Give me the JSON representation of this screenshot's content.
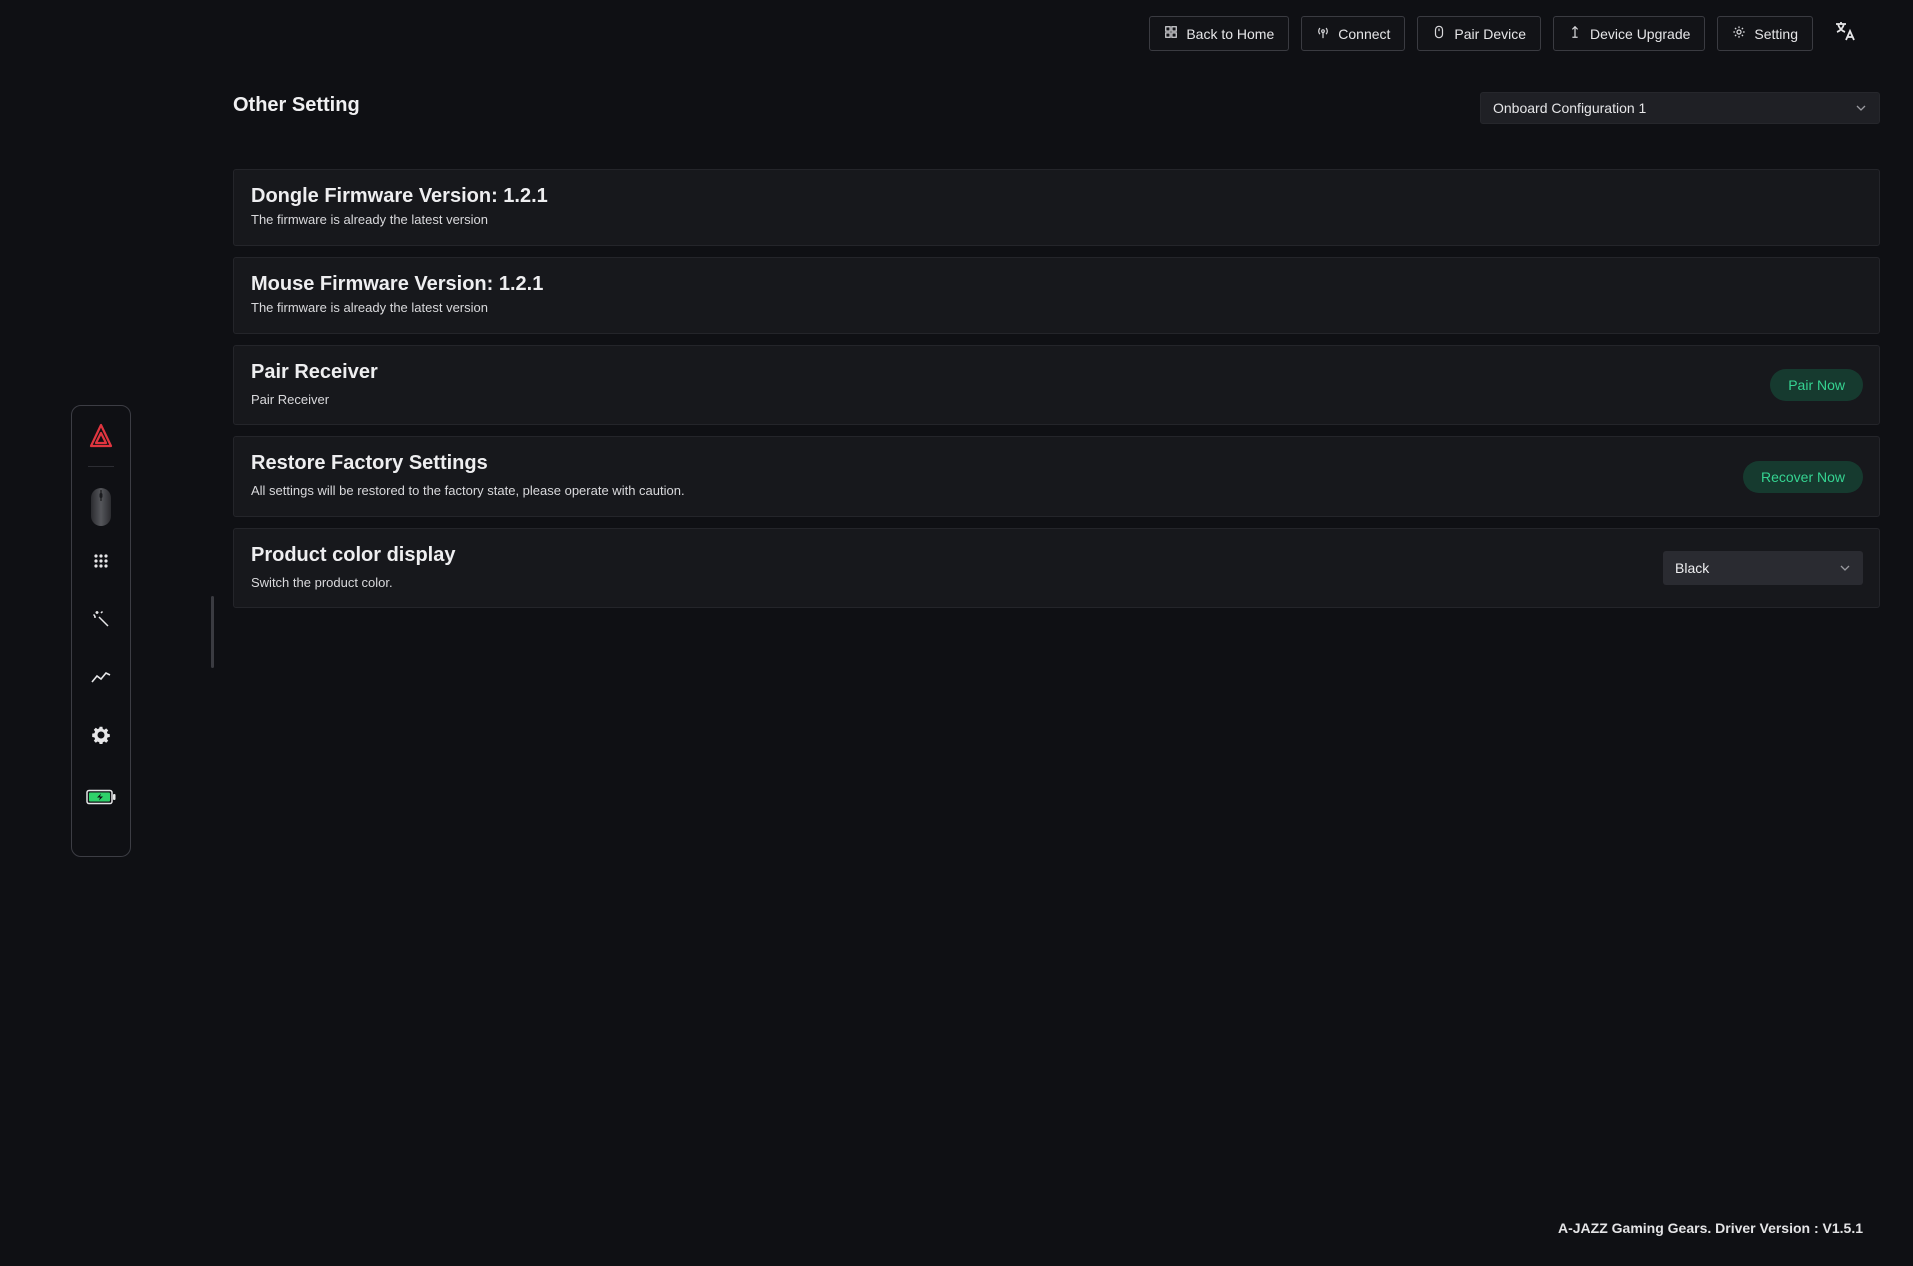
{
  "topbar": {
    "back_to_home": "Back to Home",
    "connect": "Connect",
    "pair_device": "Pair Device",
    "device_upgrade": "Device Upgrade",
    "setting": "Setting",
    "language_icon": "translate-icon"
  },
  "page": {
    "title": "Other Setting",
    "config_select": "Onboard Configuration 1"
  },
  "sidebar": {
    "items": [
      {
        "name": "brand-logo",
        "icon": "a-jazz-logo"
      },
      {
        "name": "mouse",
        "icon": "mouse-icon"
      },
      {
        "name": "keys",
        "icon": "grid-icon"
      },
      {
        "name": "lighting",
        "icon": "magic-wand-icon"
      },
      {
        "name": "performance",
        "icon": "line-chart-icon"
      },
      {
        "name": "settings",
        "icon": "gear-icon"
      },
      {
        "name": "battery",
        "icon": "battery-icon"
      }
    ]
  },
  "rows": {
    "dongle": {
      "title": "Dongle Firmware Version: 1.2.1",
      "desc": "The firmware is already the latest version"
    },
    "mouse": {
      "title": "Mouse Firmware Version: 1.2.1",
      "desc": "The firmware is already the latest version"
    },
    "pair": {
      "title": "Pair Receiver",
      "desc": "Pair Receiver",
      "button": "Pair Now"
    },
    "restore": {
      "title": "Restore Factory Settings",
      "desc": "All settings will be restored to the factory state, please operate with caution.",
      "button": "Recover Now"
    },
    "color": {
      "title": "Product color display",
      "desc": "Switch the product color.",
      "select": "Black"
    }
  },
  "footer": {
    "text": "A-JAZZ Gaming Gears. Driver Version : V1.5.1"
  },
  "colors": {
    "background": "#0f1014",
    "card": "#17181c",
    "accent_green": "#35d391",
    "accent_green_bg": "#163a2f",
    "brand_red": "#e0353f",
    "battery_green": "#2fd16a"
  }
}
